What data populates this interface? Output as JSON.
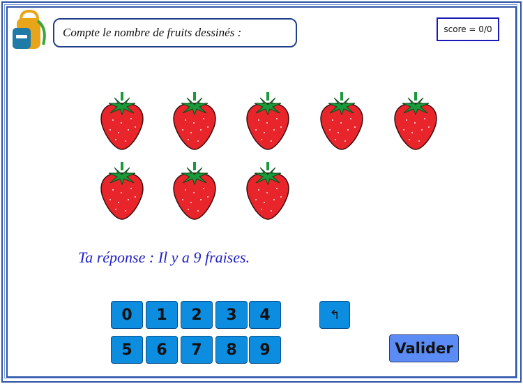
{
  "header": {
    "prompt": "Compte le nombre de fruits dessinés :",
    "score": "score = 0/0"
  },
  "fruits": {
    "name": "strawberry",
    "count_shown": 8
  },
  "answer": {
    "text": "Ta réponse : Il y a 9 fraises."
  },
  "keypad": {
    "keys": [
      "0",
      "1",
      "2",
      "3",
      "4",
      "5",
      "6",
      "7",
      "8",
      "9"
    ],
    "backspace": "↰",
    "validate": "Valider"
  },
  "colors": {
    "frame": "#2b52a6",
    "key": "#0c8de0",
    "validate": "#5b8cf5",
    "answer_text": "#2020c8",
    "strawberry": "#e8252a",
    "leaves": "#1a9a3a"
  }
}
